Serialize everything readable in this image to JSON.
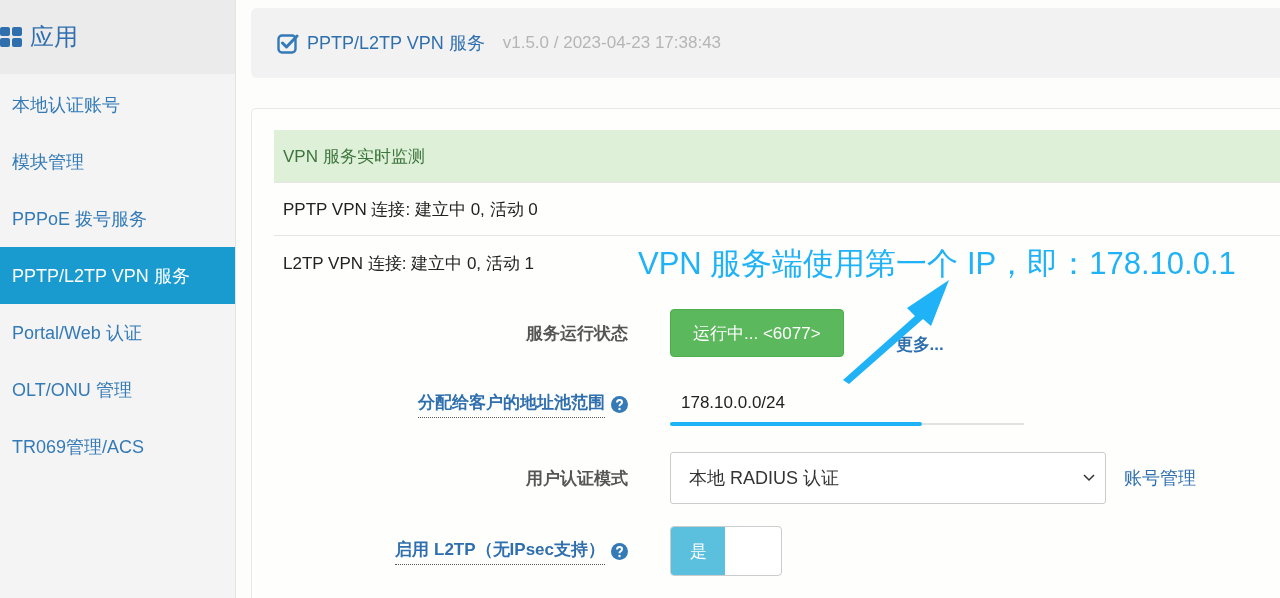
{
  "sidebar": {
    "title": "应用",
    "items": [
      {
        "label": "本地认证账号",
        "selected": false
      },
      {
        "label": "模块管理",
        "selected": false
      },
      {
        "label": "PPPoE 拨号服务",
        "selected": false
      },
      {
        "label": "PPTP/L2TP VPN 服务",
        "selected": true
      },
      {
        "label": "Portal/Web 认证",
        "selected": false
      },
      {
        "label": "OLT/ONU 管理",
        "selected": false
      },
      {
        "label": "TR069管理/ACS",
        "selected": false
      }
    ]
  },
  "header": {
    "title": "PPTP/L2TP VPN 服务",
    "version": "v1.5.0 / 2023-04-23 17:38:43"
  },
  "monitor": {
    "title": "VPN 服务实时监测",
    "rows": [
      "PPTP VPN 连接: 建立中 0, 活动 0",
      "L2TP VPN 连接: 建立中 0, 活动 1"
    ]
  },
  "form": [
    {
      "kind": "status",
      "label": "服务运行状态",
      "help": false,
      "value": "运行中... <6077>",
      "link": "更多..."
    },
    {
      "kind": "input",
      "label": "分配给客户的地址池范围",
      "help": true,
      "value": "178.10.0.0/24",
      "focused": true
    },
    {
      "kind": "select",
      "label": "用户认证模式",
      "help": false,
      "value": "本地 RADIUS 认证",
      "link": "账号管理"
    },
    {
      "kind": "toggle",
      "label": "启用 L2TP（无IPsec支持）",
      "help": true,
      "value": "是",
      "on": true
    }
  ],
  "annotation": {
    "text": "VPN 服务端使用第一个 IP，即：178.10.0.1"
  }
}
